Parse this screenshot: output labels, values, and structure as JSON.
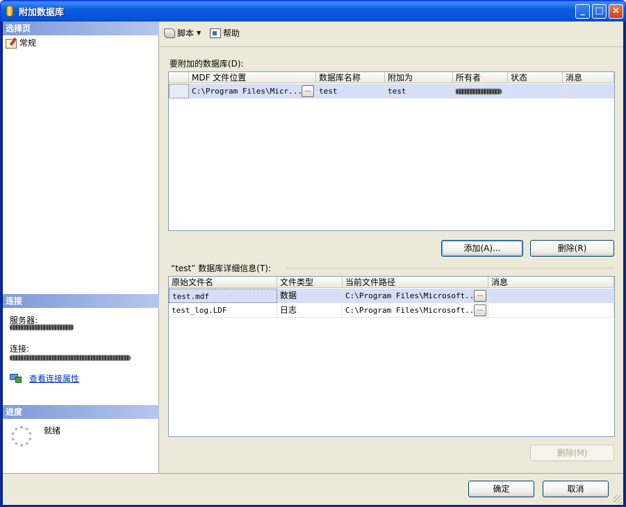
{
  "window": {
    "title": "附加数据库",
    "min_label": "_",
    "max_label": "□",
    "close_label": "×"
  },
  "left": {
    "select_page_header": "选择页",
    "page_general": "常规",
    "connection_header": "连接",
    "server_label": "服务器:",
    "connection_label": "连接:",
    "view_connection_link": "查看连接属性",
    "progress_header": "进度",
    "progress_status": "就绪"
  },
  "toolbar": {
    "script_label": "脚本",
    "help_label": "帮助"
  },
  "attach_section": {
    "label": "要附加的数据库(D):",
    "columns": [
      "MDF 文件位置",
      "数据库名称",
      "附加为",
      "所有者",
      "状态",
      "消息"
    ],
    "rows": [
      {
        "mdf_location": "C:\\Program Files\\Micr...",
        "ellipsis": "...",
        "db_name": "test",
        "attach_as": "test",
        "status": "",
        "message": ""
      }
    ],
    "add_button": "添加(A)...",
    "remove_button": "删除(R)"
  },
  "details_section": {
    "label": "“test” 数据库详细信息(T):",
    "columns": [
      "原始文件名",
      "文件类型",
      "当前文件路径",
      "消息"
    ],
    "rows": [
      {
        "original_file": "test.mdf",
        "file_type": "数据",
        "current_path": "C:\\Program Files\\Microsoft...",
        "ellipsis": "...",
        "message": ""
      },
      {
        "original_file": "test_log.LDF",
        "file_type": "日志",
        "current_path": "C:\\Program Files\\Microsoft...",
        "ellipsis": "...",
        "message": ""
      }
    ],
    "remove_button": "删除(M)"
  },
  "footer": {
    "ok_button": "确定",
    "cancel_button": "取消"
  },
  "colors": {
    "title_blue": "#0A5FE8",
    "section_header": "#7E99D8",
    "link": "#0033CC",
    "selected_row": "#D6DFF7"
  }
}
